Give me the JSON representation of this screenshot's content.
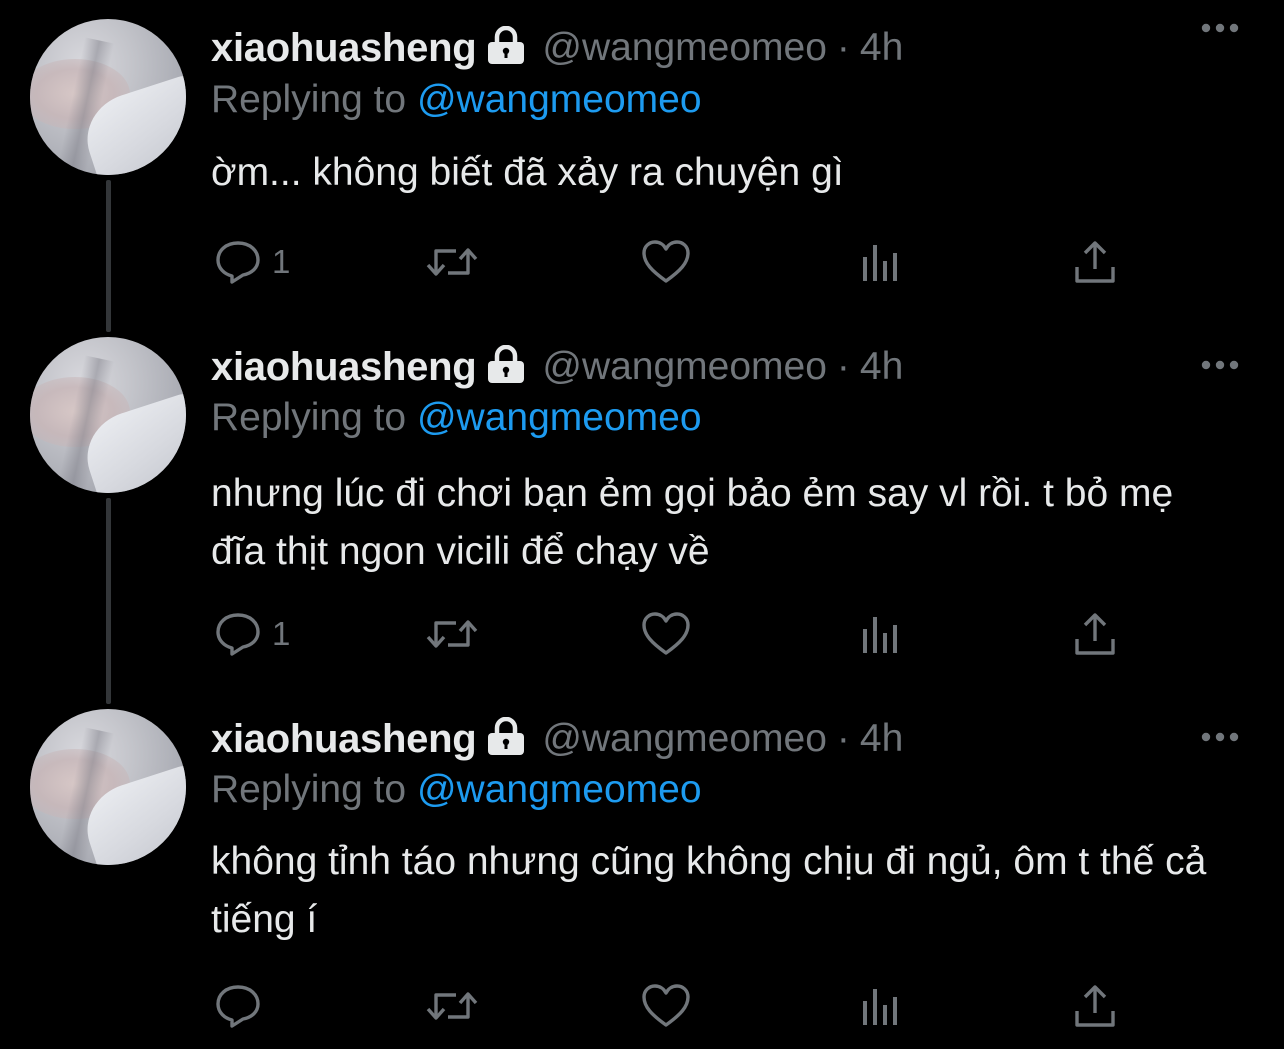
{
  "colors": {
    "background": "#000000",
    "text": "#e7e9ea",
    "muted": "#71767b",
    "accent": "#1d9bf0"
  },
  "tweets": [
    {
      "name": "xiaohuasheng",
      "handle": "@wangmeomeo",
      "separator": "·",
      "time": "4h",
      "replying_prefix": "Replying to ",
      "replying_to": "@wangmeomeo",
      "text": "ờm... không biết đã xảy ra chuyện gì",
      "reply_count": "1",
      "icons": [
        "lock-icon",
        "more-icon",
        "reply-icon",
        "retweet-icon",
        "like-icon",
        "analytics-icon",
        "share-icon"
      ]
    },
    {
      "name": "xiaohuasheng",
      "handle": "@wangmeomeo",
      "separator": "·",
      "time": "4h",
      "replying_prefix": "Replying to ",
      "replying_to": "@wangmeomeo",
      "text": "nhưng lúc đi chơi bạn ẻm gọi bảo ẻm say vl rồi. t bỏ mẹ đĩa thịt ngon vicili để chạy về",
      "reply_count": "1",
      "icons": [
        "lock-icon",
        "more-icon",
        "reply-icon",
        "retweet-icon",
        "like-icon",
        "analytics-icon",
        "share-icon"
      ]
    },
    {
      "name": "xiaohuasheng",
      "handle": "@wangmeomeo",
      "separator": "·",
      "time": "4h",
      "replying_prefix": "Replying to ",
      "replying_to": "@wangmeomeo",
      "text": "không tỉnh táo nhưng cũng không chịu đi ngủ, ôm t thế cả tiếng í",
      "reply_count": "",
      "icons": [
        "lock-icon",
        "more-icon",
        "reply-icon",
        "retweet-icon",
        "like-icon",
        "analytics-icon",
        "share-icon"
      ]
    }
  ]
}
